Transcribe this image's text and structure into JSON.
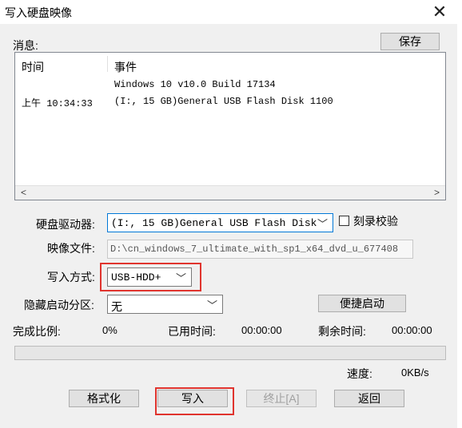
{
  "window": {
    "title": "写入硬盘映像",
    "close_glyph": "✕"
  },
  "messages": {
    "label": "消息:",
    "save_label": "保存",
    "columns": [
      "时间",
      "事件"
    ],
    "rows": [
      {
        "time": "",
        "event": "Windows 10 v10.0 Build 17134"
      },
      {
        "time": "上午 10:34:33",
        "event": "(I:, 15 GB)General USB Flash Disk  1100"
      }
    ],
    "scroll_left": "<",
    "scroll_right": ">"
  },
  "form": {
    "drive_label": "硬盘驱动器:",
    "drive_value": "(I:, 15 GB)General USB Flash Disk",
    "verify_label": "刻录校验",
    "image_label": "映像文件:",
    "image_value": "D:\\cn_windows_7_ultimate_with_sp1_x64_dvd_u_677408",
    "write_mode_label": "写入方式:",
    "write_mode_value": "USB-HDD+",
    "hide_partition_label": "隐藏启动分区:",
    "hide_partition_value": "无",
    "quick_boot_label": "便捷启动"
  },
  "status": {
    "percent_label": "完成比例:",
    "percent_value": "0%",
    "elapsed_label": "已用时间:",
    "elapsed_value": "00:00:00",
    "remaining_label": "剩余时间:",
    "remaining_value": "00:00:00",
    "speed_label": "速度:",
    "speed_value": "0KB/s",
    "progress_fraction": 0
  },
  "buttons": {
    "format": "格式化",
    "write": "写入",
    "stop": "终止[A]",
    "back": "返回"
  },
  "colors": {
    "highlight": "#e0342e"
  }
}
